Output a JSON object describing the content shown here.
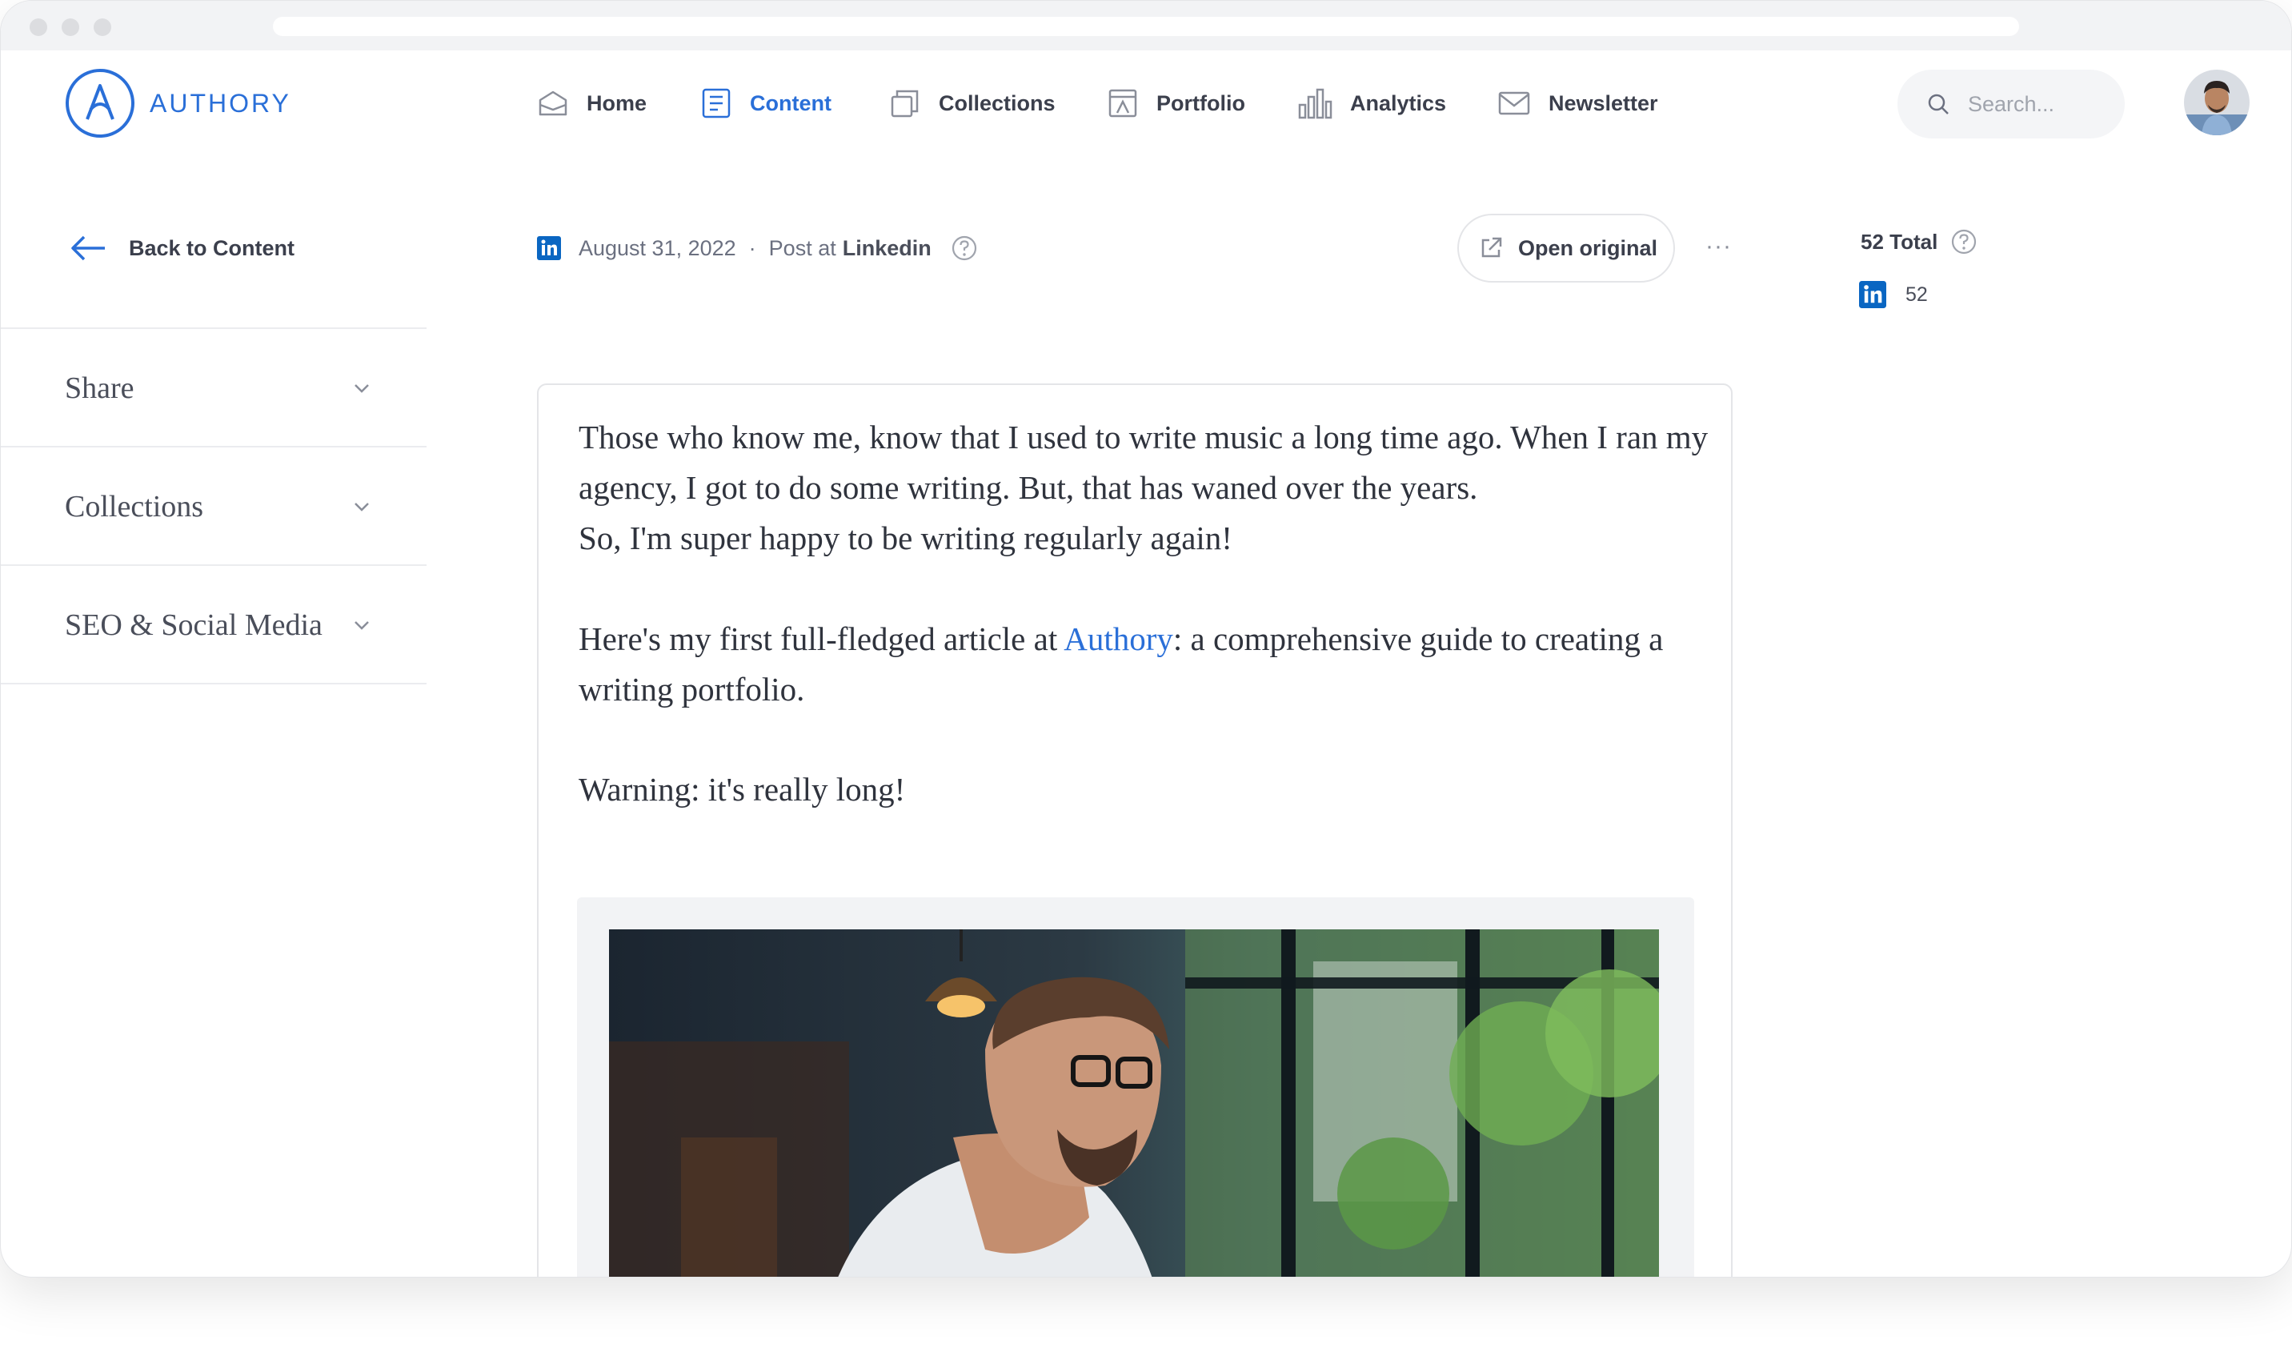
{
  "app": {
    "brand": "AUTHORY",
    "accent": "#2a6fd8",
    "linkedin_color": "#0a66c2"
  },
  "nav": {
    "items": [
      {
        "label": "Home",
        "icon": "home-icon"
      },
      {
        "label": "Content",
        "icon": "document-icon",
        "active": true
      },
      {
        "label": "Collections",
        "icon": "collections-icon"
      },
      {
        "label": "Portfolio",
        "icon": "portfolio-icon"
      },
      {
        "label": "Analytics",
        "icon": "bar-chart-icon"
      },
      {
        "label": "Newsletter",
        "icon": "envelope-icon"
      }
    ]
  },
  "search": {
    "placeholder": "Search..."
  },
  "sidebar": {
    "back_label": "Back to Content",
    "sections": [
      "Share",
      "Collections",
      "SEO & Social Media"
    ]
  },
  "post": {
    "date": "August 31, 2022",
    "separator": "·",
    "type_prefix": "Post at",
    "platform": "Linkedin",
    "open_label": "Open original",
    "more_label": "···"
  },
  "stats": {
    "total_label": "52 Total",
    "linkedin_count": "52"
  },
  "content": {
    "p1": "Those who know me, know that I used to write music a long time ago. When I ran my agency, I got to do some writing. But, that has waned over the years.",
    "p2": "So, I'm super happy to be writing regularly again!",
    "p3_before": "Here's my first full-fledged article at ",
    "p3_link": "Authory",
    "p3_after": ": a comprehensive guide to creating a writing portfolio.",
    "p4": "Warning: it's really long!"
  }
}
